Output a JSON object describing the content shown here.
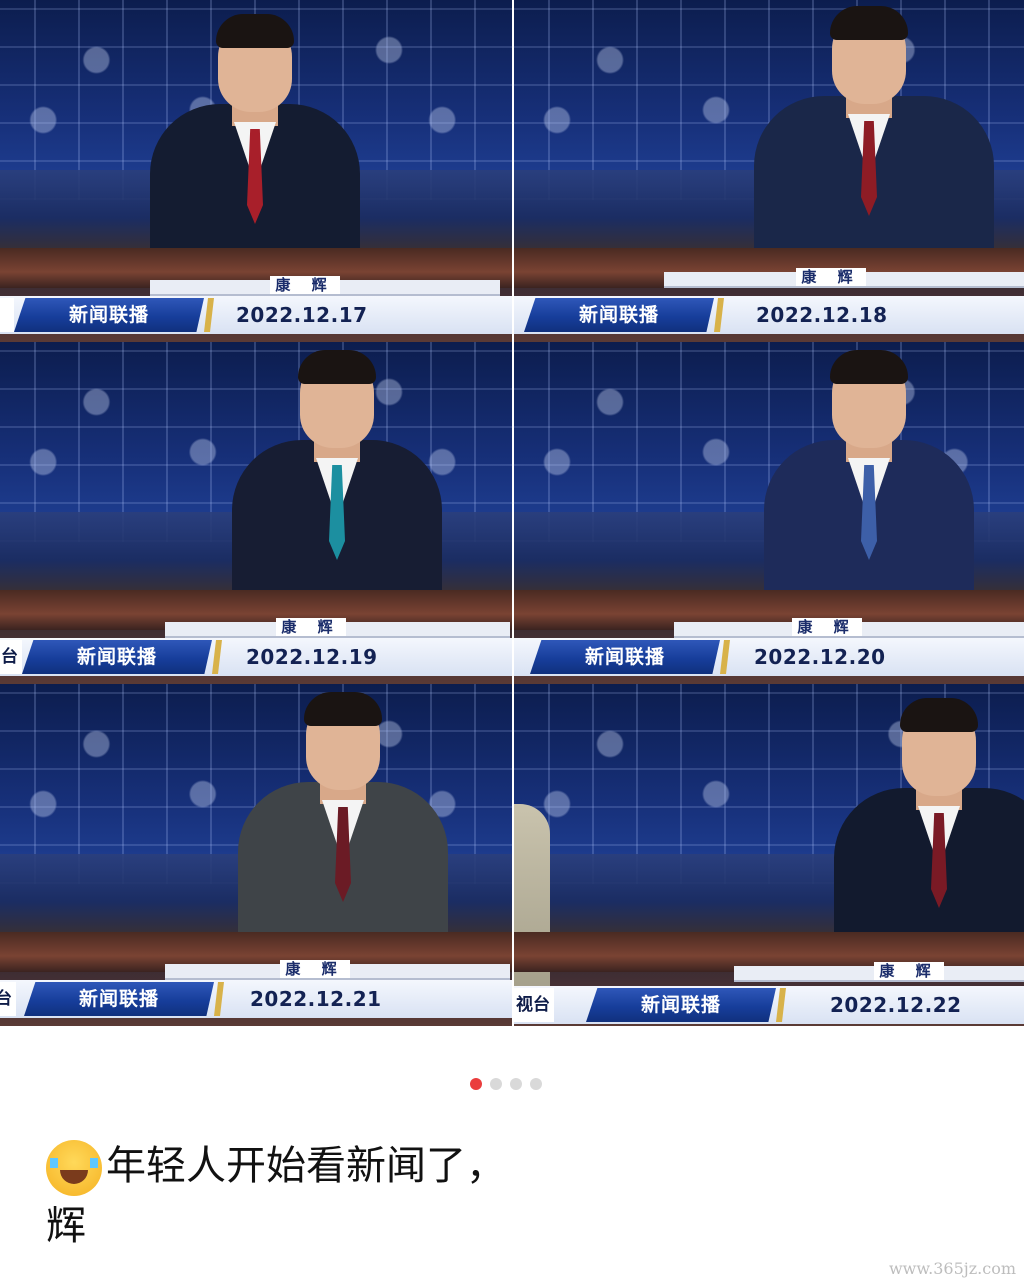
{
  "frames": [
    {
      "show": "新闻联播",
      "name": "康 辉",
      "date": "2022.12.17",
      "tie": "#a81f2a",
      "suit": "#141c31",
      "tail": ""
    },
    {
      "show": "新闻联播",
      "name": "康 辉",
      "date": "2022.12.18",
      "tie": "#8e1c25",
      "suit": "#1a2749",
      "tail": ""
    },
    {
      "show": "新闻联播",
      "name": "康 辉",
      "date": "2022.12.19",
      "tie": "#1c8fa0",
      "suit": "#171d33",
      "tail": "台"
    },
    {
      "show": "新闻联播",
      "name": "康 辉",
      "date": "2022.12.20",
      "tie": "#3d5fa8",
      "suit": "#1e2b5a",
      "tail": ""
    },
    {
      "show": "新闻联播",
      "name": "康 辉",
      "date": "2022.12.21",
      "tie": "#6b1b25",
      "suit": "#3f4448",
      "tail": "台"
    },
    {
      "show": "新闻联播",
      "name": "康 辉",
      "date": "2022.12.22",
      "tie": "#7a1a25",
      "suit": "#121a2e",
      "tail": "视台"
    }
  ],
  "pagination": {
    "total": 4,
    "active": 1
  },
  "caption": {
    "line1": "年轻人开始看新闻了，",
    "line2": "辉",
    "emoji": "tears-of-joy-emoji"
  },
  "watermark": "www.365jz.com"
}
